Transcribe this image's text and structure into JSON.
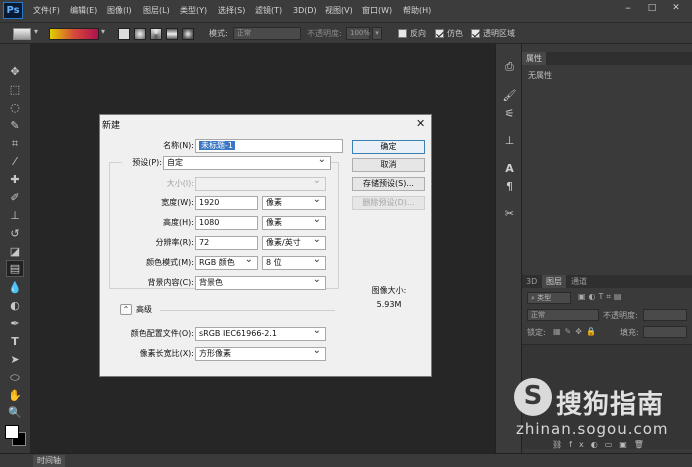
{
  "app": {
    "logo": "Ps",
    "menu": [
      "文件(F)",
      "编辑(E)",
      "图像(I)",
      "图层(L)",
      "类型(Y)",
      "选择(S)",
      "滤镜(T)",
      "3D(D)",
      "视图(V)",
      "窗口(W)",
      "帮助(H)"
    ],
    "window_controls": [
      "–",
      "□",
      "✕"
    ],
    "accent": "#2a78c9"
  },
  "options_bar": {
    "mode_label": "模式:",
    "mode_value": "正常",
    "opacity_label": "不透明度:",
    "opacity_value": "100%",
    "reverse_label": "反向",
    "dither_label": "仿色",
    "transparency_label": "透明区域",
    "dither_checked": true,
    "transparency_checked": true,
    "gradient_colors": [
      "#e0d000",
      "#d64a3a",
      "#b01050"
    ]
  },
  "panels": {
    "properties_tab": "属性",
    "properties_empty": "无属性",
    "layer_tabs": [
      "3D",
      "图层",
      "通道"
    ],
    "kind_filter": "类型",
    "blend_mode": "正常",
    "opacity_label": "不透明度:",
    "lock_label": "锁定:",
    "fill_label": "填充:"
  },
  "timeline": {
    "label": "时间轴"
  },
  "dialog": {
    "title": "新建",
    "name_label": "名称(N):",
    "name_value": "未标题-1",
    "preset_label": "预设(P):",
    "preset_value": "自定",
    "size_label": "大小(I):",
    "width_label": "宽度(W):",
    "width_value": "1920",
    "width_unit": "像素",
    "height_label": "高度(H):",
    "height_value": "1080",
    "height_unit": "像素",
    "resolution_label": "分辨率(R):",
    "resolution_value": "72",
    "resolution_unit": "像素/英寸",
    "color_mode_label": "颜色模式(M):",
    "color_mode_value": "RGB 颜色",
    "bit_depth_value": "8 位",
    "background_label": "背景内容(C):",
    "background_value": "背景色",
    "advanced_label": "高级",
    "color_profile_label": "颜色配置文件(O):",
    "color_profile_value": "sRGB IEC61966-2.1",
    "pixel_aspect_label": "像素长宽比(X):",
    "pixel_aspect_value": "方形像素",
    "ok_button": "确定",
    "cancel_button": "取消",
    "save_preset_button": "存储预设(S)...",
    "delete_preset_button": "删除预设(D)...",
    "image_size_label": "图像大小:",
    "image_size_value": "5.93M"
  },
  "watermark": {
    "brand": "搜狗指南",
    "url": "zhinan.sogou.com"
  }
}
